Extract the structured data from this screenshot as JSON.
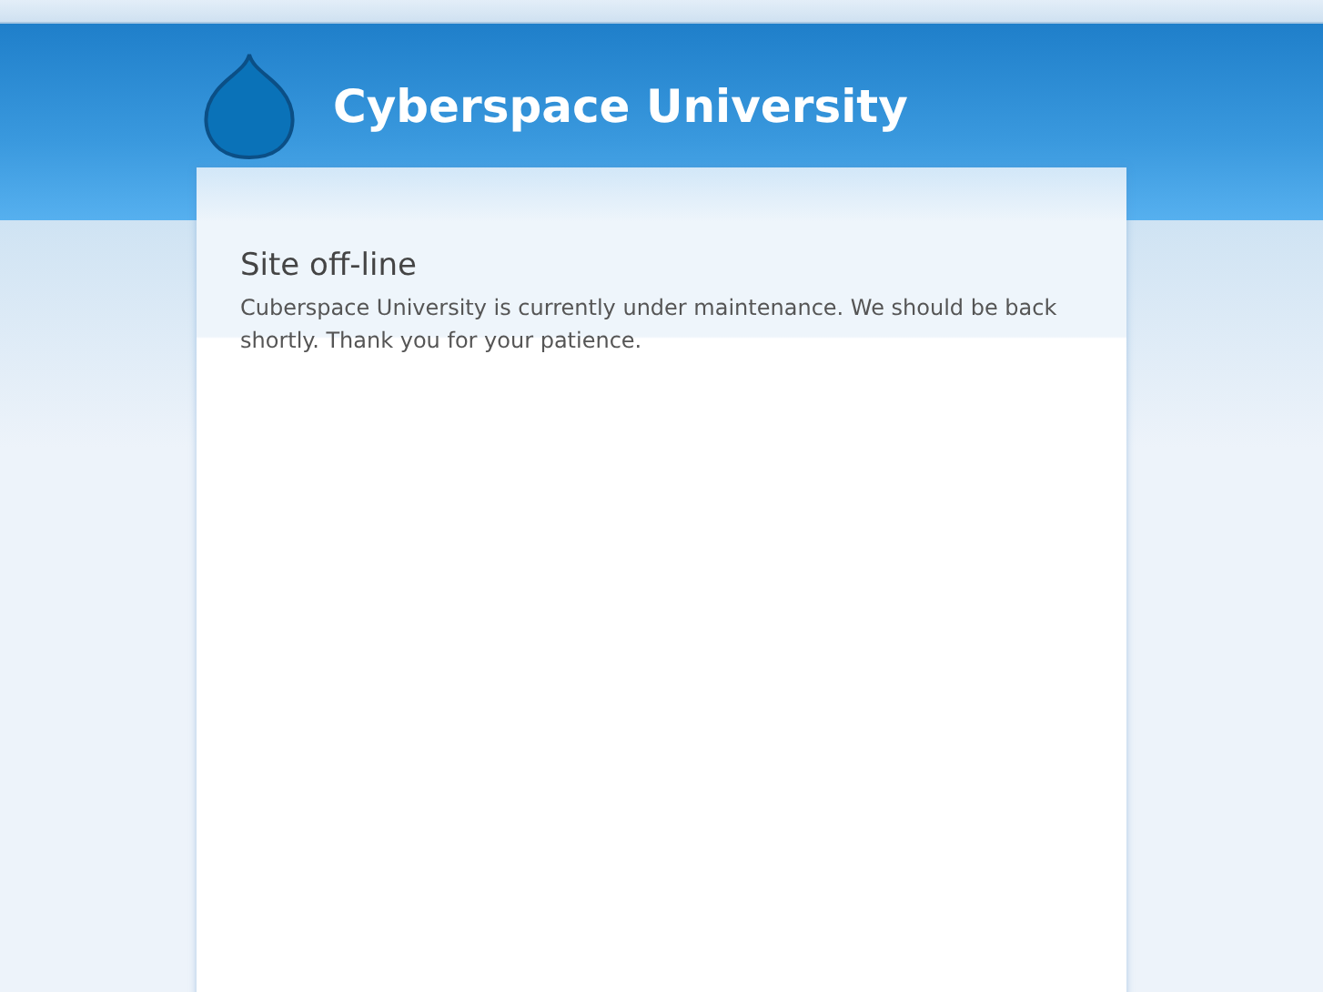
{
  "header": {
    "site_name": "Cyberspace University"
  },
  "content": {
    "title": "Site off-line",
    "message": "Cuberspace University is currently under maintenance. We should be back shortly. Thank you for your patience."
  }
}
